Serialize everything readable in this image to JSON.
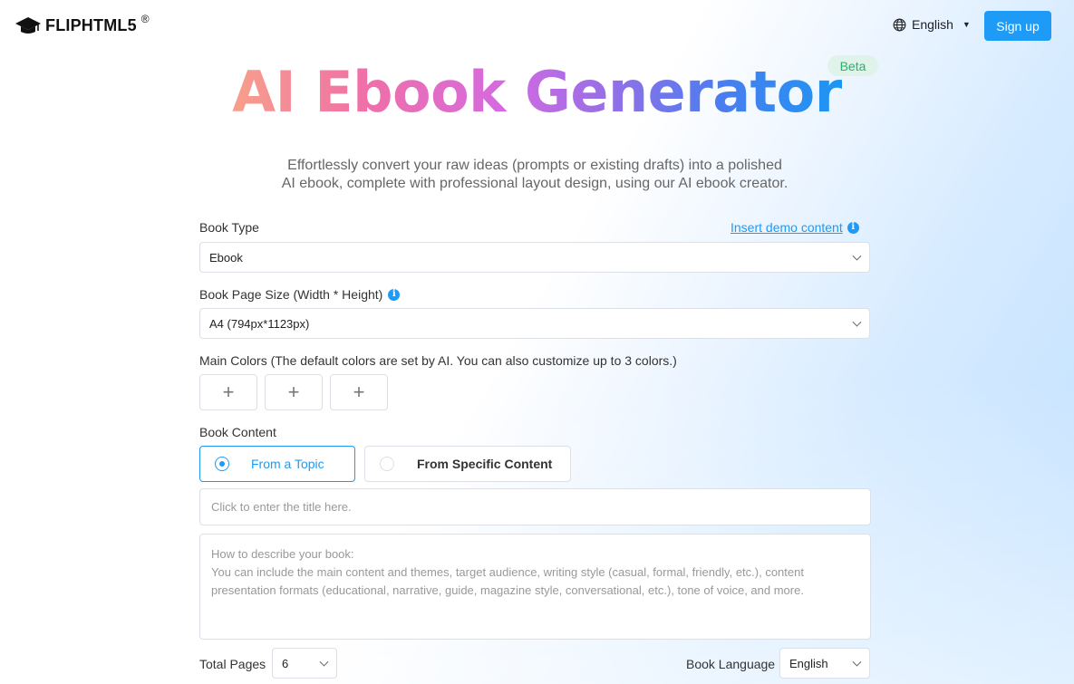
{
  "header": {
    "logo_text": "FLIPHTML5",
    "logo_reg": "®",
    "language": "English",
    "signup_label": "Sign up"
  },
  "hero": {
    "title": "AI Ebook Generator",
    "badge": "Beta",
    "subtitle_line1": "Effortlessly convert your raw ideas (prompts or existing drafts) into a polished",
    "subtitle_line2": "AI ebook, complete with professional layout design, using our AI ebook creator."
  },
  "form": {
    "book_type": {
      "label": "Book Type",
      "value": "Ebook",
      "demo_link": "Insert demo content"
    },
    "page_size": {
      "label": "Book Page Size (Width * Height)",
      "value": "A4 (794px*1123px)"
    },
    "colors": {
      "label": "Main Colors (The default colors are set by AI. You can also customize up to 3 colors.)",
      "add_symbol": "+"
    },
    "content": {
      "label": "Book Content",
      "options": [
        {
          "label": "From a Topic",
          "selected": true
        },
        {
          "label": "From Specific Content",
          "selected": false
        }
      ],
      "title_placeholder": "Click to enter the title here.",
      "description_placeholder_line1": "How to describe your book:",
      "description_placeholder_line2": "You can include the main content and themes, target audience, writing style (casual, formal, friendly, etc.), content",
      "description_placeholder_line3": "presentation formats (educational, narrative, guide, magazine style, conversational, etc.), tone of voice, and more."
    },
    "total_pages": {
      "label": "Total Pages",
      "value": "6"
    },
    "book_language": {
      "label": "Book Language",
      "value": "English"
    }
  },
  "colors": {
    "accent": "#1d9bf6",
    "beta_bg": "#dff3ea",
    "beta_text": "#27b36a"
  },
  "icons": [
    "logo-cap-icon",
    "globe-icon",
    "caret-down-icon",
    "info-icon",
    "chevron-down-icon",
    "plus-icon"
  ]
}
